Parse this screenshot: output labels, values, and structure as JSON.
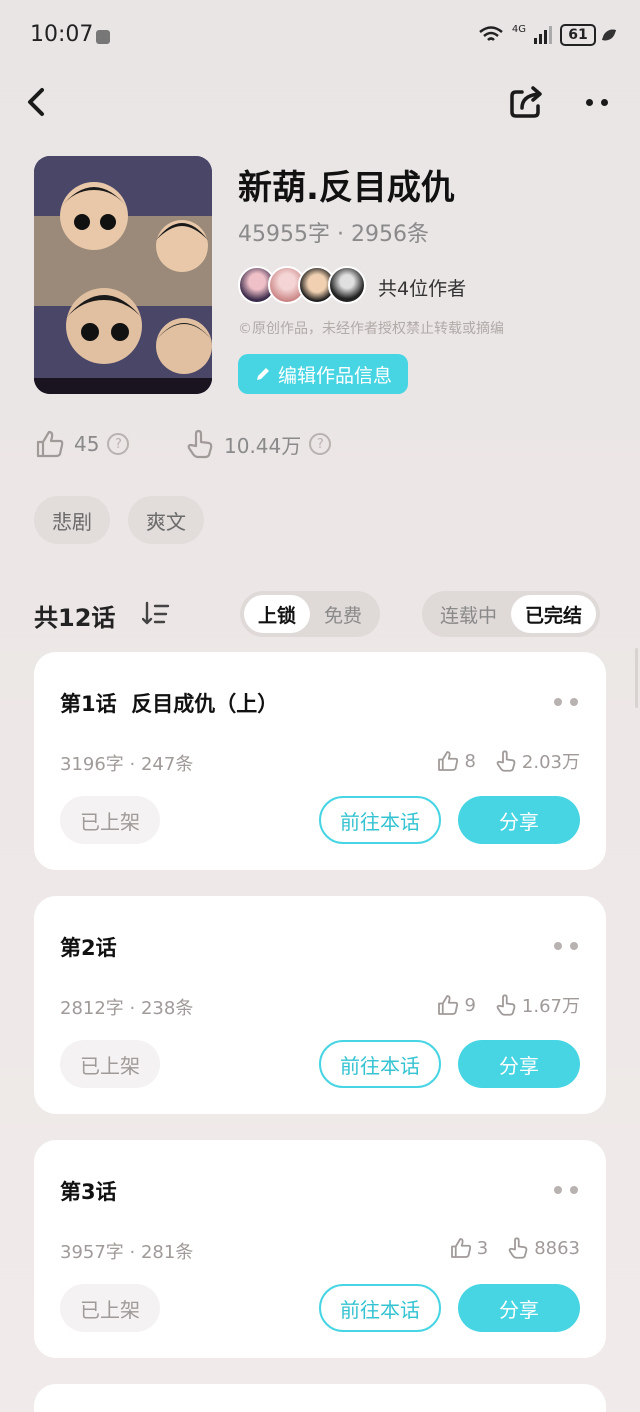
{
  "status_bar": {
    "time": "10:07",
    "network": "4G",
    "battery": "61"
  },
  "nav": {
    "back_icon": "chevron-left-icon",
    "share_icon": "share-icon",
    "more_icon": "more-dots-icon"
  },
  "book": {
    "title": "新葫.反目成仇",
    "meta": "45955字 · 2956条",
    "authors_text": "共4位作者",
    "copyright": "©原创作品，未经作者授权禁止转载或摘编",
    "edit_button": "编辑作品信息",
    "likes": "45",
    "views": "10.44万",
    "tags": [
      "悲剧",
      "爽文"
    ]
  },
  "chapters_header": {
    "count": "共12话",
    "lock_filter": {
      "options": [
        "上锁",
        "免费"
      ],
      "selected": "上锁"
    },
    "status_filter": {
      "options": [
        "连载中",
        "已完结"
      ],
      "selected": "已完结"
    }
  },
  "chapters": [
    {
      "title": "第1话  反目成仇（上）",
      "meta": "3196字 · 247条",
      "likes": "8",
      "views": "2.03万",
      "status": "已上架",
      "goto_label": "前往本话",
      "share_label": "分享"
    },
    {
      "title": "第2话",
      "meta": "2812字 · 238条",
      "likes": "9",
      "views": "1.67万",
      "status": "已上架",
      "goto_label": "前往本话",
      "share_label": "分享"
    },
    {
      "title": "第3话",
      "meta": "3957字 · 281条",
      "likes": "3",
      "views": "8863",
      "status": "已上架",
      "goto_label": "前往本话",
      "share_label": "分享"
    }
  ],
  "colors": {
    "accent": "#47d5e3",
    "background": "#ece7e6"
  }
}
